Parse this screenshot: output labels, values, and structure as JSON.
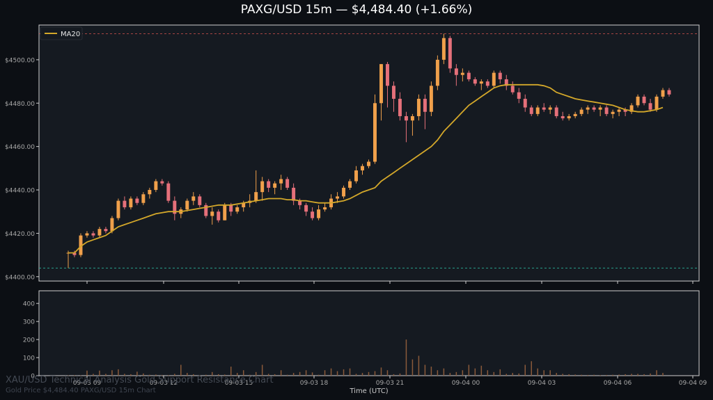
{
  "title": "PAXG/USD 15m — $4,484.40 (+1.66%)",
  "watermark": {
    "line1": "XAU/USD Technical Analysis Gold Support Resistance Chart",
    "line2": "Gold Price $4,484.40 PAXG/USD 15m Chart"
  },
  "colors": {
    "background": "#0c0f14",
    "panel": "#151a21",
    "up": "#f0a04b",
    "down": "#e5707a",
    "ma": "#d4a82a",
    "resistance": "#d9534f",
    "support": "#2bb39a",
    "volume": "#8a5a3a"
  },
  "chart_data": {
    "type": "candlestick",
    "title": "PAXG/USD 15m — $4,484.40 (+1.66%)",
    "xlabel": "Time (UTC)",
    "x_ticks": [
      "09-03 09",
      "09-03 12",
      "09-03 15",
      "09-03 18",
      "09-03 21",
      "09-04 00",
      "09-04 03",
      "09-04 06",
      "09-04 09"
    ],
    "price_ylim": [
      4398,
      4516
    ],
    "price_ticks": [
      "$4400.00",
      "$4420.00",
      "$4440.00",
      "$4460.00",
      "$4480.00",
      "$4500.00"
    ],
    "price_tick_values": [
      4400,
      4420,
      4440,
      4460,
      4480,
      4500
    ],
    "volume_ylim": [
      0,
      470
    ],
    "volume_ticks": [
      "0",
      "100",
      "200",
      "300",
      "400"
    ],
    "volume_tick_values": [
      0,
      100,
      200,
      300,
      400
    ],
    "resistance_level": 4512,
    "support_level": 4404,
    "legend": {
      "label": "MA20",
      "position": "top-left"
    },
    "ohlc": [
      [
        4411,
        4412,
        4404,
        4411
      ],
      [
        4411,
        4412,
        4409,
        4410
      ],
      [
        4410,
        4420,
        4409,
        4419
      ],
      [
        4419,
        4421,
        4418,
        4420
      ],
      [
        4420,
        4421,
        4418,
        4419
      ],
      [
        4419,
        4423,
        4418,
        4422
      ],
      [
        4422,
        4423,
        4420,
        4421
      ],
      [
        4421,
        4428,
        4420,
        4427
      ],
      [
        4427,
        4436,
        4426,
        4435
      ],
      [
        4435,
        4437,
        4431,
        4432
      ],
      [
        4432,
        4437,
        4431,
        4436
      ],
      [
        4436,
        4437,
        4433,
        4434
      ],
      [
        4434,
        4439,
        4433,
        4438
      ],
      [
        4438,
        4441,
        4436,
        4440
      ],
      [
        4440,
        4445,
        4439,
        4444
      ],
      [
        4444,
        4445,
        4442,
        4443
      ],
      [
        4443,
        4444,
        4434,
        4435
      ],
      [
        4435,
        4437,
        4426,
        4429
      ],
      [
        4429,
        4432,
        4427,
        4431
      ],
      [
        4431,
        4436,
        4430,
        4435
      ],
      [
        4435,
        4439,
        4433,
        4437
      ],
      [
        4437,
        4438,
        4432,
        4433
      ],
      [
        4433,
        4434,
        4427,
        4428
      ],
      [
        4428,
        4432,
        4424,
        4430
      ],
      [
        4430,
        4431,
        4425,
        4426
      ],
      [
        4426,
        4434,
        4426,
        4433
      ],
      [
        4433,
        4434,
        4428,
        4430
      ],
      [
        4430,
        4433,
        4429,
        4432
      ],
      [
        4432,
        4435,
        4430,
        4434
      ],
      [
        4434,
        4438,
        4432,
        4435
      ],
      [
        4435,
        4449,
        4434,
        4439
      ],
      [
        4439,
        4446,
        4435,
        4444
      ],
      [
        4444,
        4445,
        4439,
        4441
      ],
      [
        4441,
        4444,
        4438,
        4443
      ],
      [
        4443,
        4447,
        4440,
        4445
      ],
      [
        4445,
        4446,
        4440,
        4441
      ],
      [
        4441,
        4443,
        4433,
        4435
      ],
      [
        4435,
        4436,
        4431,
        4433
      ],
      [
        4433,
        4434,
        4428,
        4430
      ],
      [
        4430,
        4432,
        4426,
        4427
      ],
      [
        4427,
        4433,
        4426,
        4431
      ],
      [
        4431,
        4434,
        4430,
        4432
      ],
      [
        4432,
        4438,
        4431,
        4436
      ],
      [
        4436,
        4439,
        4434,
        4437
      ],
      [
        4437,
        4442,
        4436,
        4441
      ],
      [
        4441,
        4445,
        4440,
        4444
      ],
      [
        4444,
        4451,
        4443,
        4449
      ],
      [
        4449,
        4452,
        4447,
        4451
      ],
      [
        4451,
        4454,
        4450,
        4453
      ],
      [
        4453,
        4484,
        4452,
        4480
      ],
      [
        4480,
        4498,
        4472,
        4498
      ],
      [
        4498,
        4499,
        4478,
        4488
      ],
      [
        4488,
        4490,
        4476,
        4482
      ],
      [
        4482,
        4485,
        4472,
        4474
      ],
      [
        4474,
        4476,
        4462,
        4472
      ],
      [
        4472,
        4475,
        4465,
        4474
      ],
      [
        4474,
        4484,
        4472,
        4482
      ],
      [
        4482,
        4484,
        4468,
        4476
      ],
      [
        4476,
        4490,
        4474,
        4488
      ],
      [
        4488,
        4502,
        4486,
        4500
      ],
      [
        4500,
        4512,
        4498,
        4510
      ],
      [
        4510,
        4511,
        4494,
        4496
      ],
      [
        4496,
        4498,
        4488,
        4493
      ],
      [
        4493,
        4496,
        4490,
        4494
      ],
      [
        4494,
        4495,
        4490,
        4491
      ],
      [
        4491,
        4492,
        4488,
        4489
      ],
      [
        4489,
        4491,
        4486,
        4490
      ],
      [
        4490,
        4491,
        4487,
        4488
      ],
      [
        4488,
        4495,
        4487,
        4494
      ],
      [
        4494,
        4495,
        4489,
        4491
      ],
      [
        4491,
        4493,
        4486,
        4488
      ],
      [
        4488,
        4490,
        4484,
        4485
      ],
      [
        4485,
        4487,
        4480,
        4482
      ],
      [
        4482,
        4484,
        4476,
        4478
      ],
      [
        4478,
        4479,
        4474,
        4475
      ],
      [
        4475,
        4479,
        4474,
        4478
      ],
      [
        4478,
        4480,
        4476,
        4477
      ],
      [
        4477,
        4479,
        4475,
        4478
      ],
      [
        4478,
        4479,
        4473,
        4474
      ],
      [
        4474,
        4476,
        4472,
        4473
      ],
      [
        4473,
        4475,
        4472,
        4474
      ],
      [
        4474,
        4476,
        4473,
        4475
      ],
      [
        4475,
        4478,
        4474,
        4477
      ],
      [
        4477,
        4479,
        4475,
        4478
      ],
      [
        4478,
        4479,
        4476,
        4477
      ],
      [
        4477,
        4479,
        4474,
        4478
      ],
      [
        4478,
        4479,
        4474,
        4475
      ],
      [
        4475,
        4477,
        4473,
        4476
      ],
      [
        4476,
        4478,
        4474,
        4477
      ],
      [
        4477,
        4478,
        4474,
        4476
      ],
      [
        4476,
        4480,
        4475,
        4479
      ],
      [
        4479,
        4484,
        4478,
        4483
      ],
      [
        4483,
        4484,
        4479,
        4480
      ],
      [
        4480,
        4482,
        4476,
        4477
      ],
      [
        4477,
        4484,
        4476,
        4483
      ],
      [
        4483,
        4487,
        4482,
        4486
      ],
      [
        4486,
        4487,
        4483,
        4484
      ]
    ],
    "volume": [
      2,
      3,
      2,
      28,
      10,
      28,
      10,
      30,
      35,
      10,
      8,
      22,
      12,
      5,
      6,
      4,
      3,
      10,
      60,
      15,
      8,
      2,
      5,
      20,
      8,
      6,
      50,
      15,
      30,
      5,
      20,
      60,
      10,
      8,
      30,
      5,
      15,
      20,
      30,
      18,
      5,
      30,
      40,
      25,
      35,
      40,
      10,
      15,
      20,
      25,
      45,
      30,
      8,
      12,
      200,
      90,
      110,
      60,
      50,
      30,
      40,
      15,
      20,
      30,
      60,
      40,
      55,
      30,
      20,
      35,
      10,
      15,
      12,
      60,
      80,
      40,
      30,
      30,
      15,
      10,
      8,
      6,
      5,
      4,
      5,
      3,
      4,
      5,
      6,
      8,
      10,
      10,
      8,
      12,
      30,
      15
    ],
    "ma20": [
      4411,
      4411,
      4414,
      4416,
      4417,
      4418,
      4419,
      4421,
      4423,
      4424,
      4425,
      4426,
      4427,
      4428,
      4429,
      4429.5,
      4430,
      4430,
      4430,
      4430.5,
      4431,
      4431.5,
      4432,
      4432.5,
      4433,
      4433,
      4433,
      4433.5,
      4434,
      4434.5,
      4435,
      4435.5,
      4436,
      4436,
      4436,
      4435.5,
      4435.5,
      4435,
      4435,
      4434.5,
      4434,
      4434,
      4434,
      4434.5,
      4435,
      4436,
      4437.5,
      4439,
      4440,
      4441,
      4444,
      4446,
      4448,
      4450,
      4452,
      4454,
      4456,
      4458,
      4460,
      4463,
      4467,
      4470,
      4473,
      4476,
      4479,
      4481,
      4483,
      4485,
      4487,
      4488,
      4488.5,
      4488.5,
      4488.5,
      4488.5,
      4488.5,
      4488.5,
      4488,
      4487,
      4485,
      4484,
      4483,
      4482,
      4481.5,
      4481,
      4480.5,
      4480,
      4479.5,
      4479,
      4478,
      4477,
      4476.5,
      4476,
      4476,
      4476.5,
      4477,
      4478
    ]
  }
}
